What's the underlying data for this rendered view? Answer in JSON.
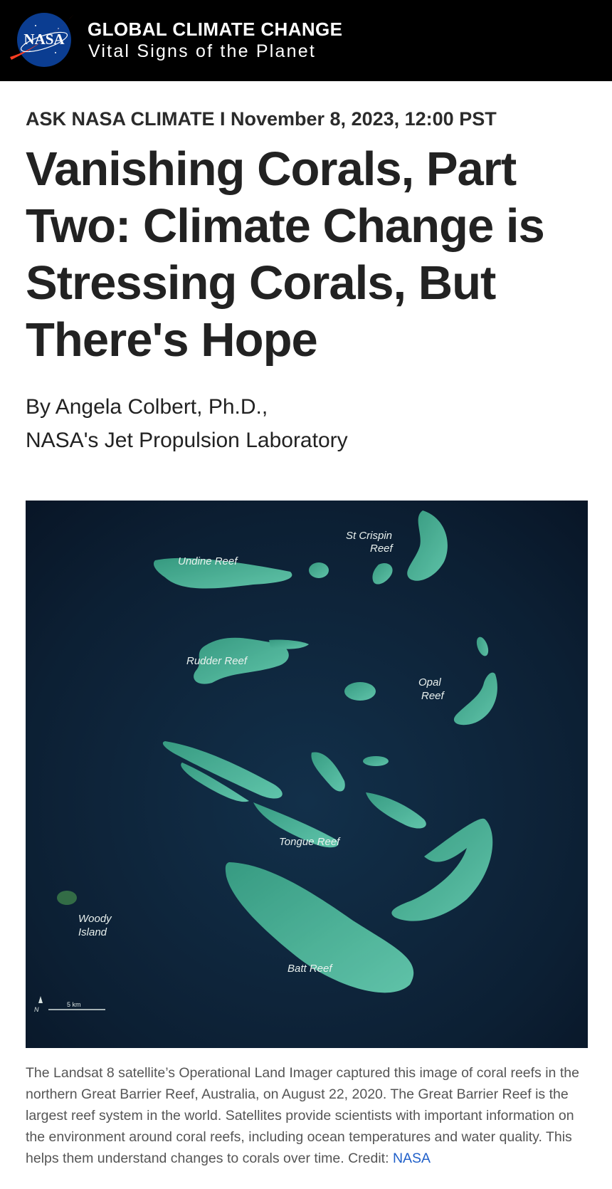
{
  "header": {
    "site_name": "GLOBAL CLIMATE CHANGE",
    "tagline": "Vital Signs of the Planet",
    "logo_text": "NASA"
  },
  "article": {
    "kicker": "ASK NASA CLIMATE I November 8, 2023, 12:00 PST",
    "title": "Vanishing Corals, Part Two: Climate Change is Stressing Corals, But There's Hope",
    "byline_author": "By Angela Colbert, Ph.D.,",
    "byline_affiliation": "NASA's Jet Propulsion Laboratory"
  },
  "figure": {
    "labels": {
      "undine": "Undine Reef",
      "st_crispin_1": "St Crispin",
      "st_crispin_2": "Reef",
      "rudder": "Rudder Reef",
      "opal_1": "Opal",
      "opal_2": "Reef",
      "tongue": "Tongue Reef",
      "woody_1": "Woody",
      "woody_2": "Island",
      "batt": "Batt Reef",
      "north": "N",
      "scale": "5 km"
    },
    "caption": "The Landsat 8 satellite’s Operational Land Imager captured this image of coral reefs in the northern Great Barrier Reef, Australia, on August 22, 2020. The Great Barrier Reef is the largest reef system in the world. Satellites provide scientists with important information on the environment around coral reefs, including ocean temperatures and water quality. This helps them understand changes to corals over time. Credit: ",
    "credit_link": "NASA"
  },
  "colors": {
    "header_bg": "#000000",
    "ocean": "#0b1a2c",
    "reef": "#4fc9a0",
    "link": "#1f5fc9"
  }
}
